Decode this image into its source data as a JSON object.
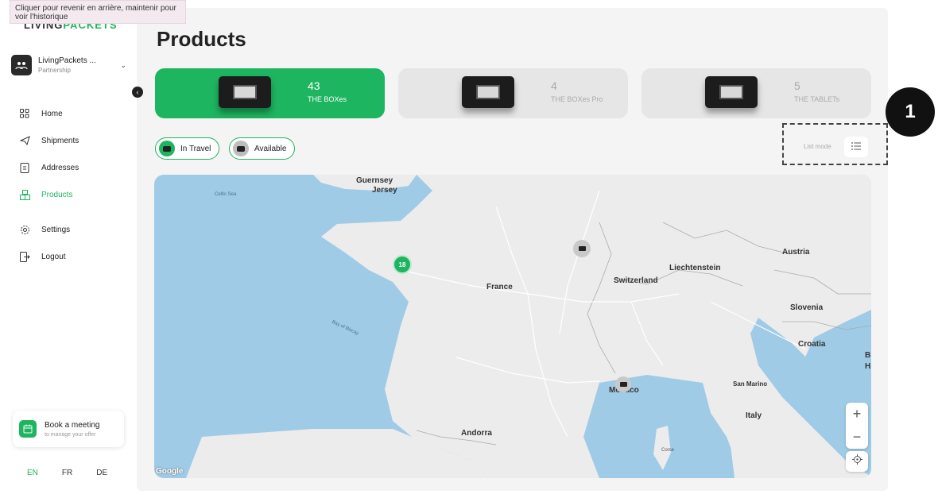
{
  "tooltip": "Cliquer pour revenir en arrière, maintenir pour voir l'historique",
  "sidebar": {
    "logo_left": "LIVING",
    "logo_right": "PACKETS",
    "account": {
      "name": "LivingPackets ...",
      "role": "Partnership"
    },
    "items": [
      {
        "label": "Home",
        "icon": "grid-icon"
      },
      {
        "label": "Shipments",
        "icon": "plane-icon"
      },
      {
        "label": "Addresses",
        "icon": "address-book-icon"
      },
      {
        "label": "Products",
        "icon": "box-icon",
        "active": true
      },
      {
        "label": "Settings",
        "icon": "gear-icon"
      },
      {
        "label": "Logout",
        "icon": "logout-icon"
      }
    ],
    "meeting": {
      "title": "Book a meeting",
      "subtitle": "to manage your offer"
    },
    "languages": [
      "EN",
      "FR",
      "DE"
    ],
    "active_language": "EN"
  },
  "page": {
    "title": "Products"
  },
  "product_cards": [
    {
      "count": "43",
      "label": "THE BOXes",
      "active": true
    },
    {
      "count": "4",
      "label": "THE BOXes Pro",
      "active": false
    },
    {
      "count": "5",
      "label": "THE TABLETs",
      "active": false
    }
  ],
  "annotation_badge": "1",
  "list_mode_label": "List mode",
  "filters": [
    {
      "label": "In Travel",
      "icon_color": "#1db560"
    },
    {
      "label": "Available",
      "icon_color": "#bdbdbd"
    }
  ],
  "map": {
    "labels": {
      "guernsey": "Guernsey",
      "jersey": "Jersey",
      "celtic_sea": "Celtic Sea",
      "bay_of_biscay": "Bay of Biscay",
      "france": "France",
      "switzerland": "Switzerland",
      "liechtenstein": "Liechtenstein",
      "austria": "Austria",
      "slovenia": "Slovenia",
      "croatia": "Croatia",
      "monaco": "Monaco",
      "san_marino": "San Marino",
      "italy": "Italy",
      "andorra": "Andorra",
      "corse": "Corse",
      "edge_b": "B",
      "edge_h": "H"
    },
    "cluster_count": "18",
    "attribution": "Google",
    "zoom_in": "+",
    "zoom_out": "−"
  },
  "colors": {
    "accent": "#1db560",
    "sea": "#9fcbe6",
    "land": "#ececec"
  }
}
